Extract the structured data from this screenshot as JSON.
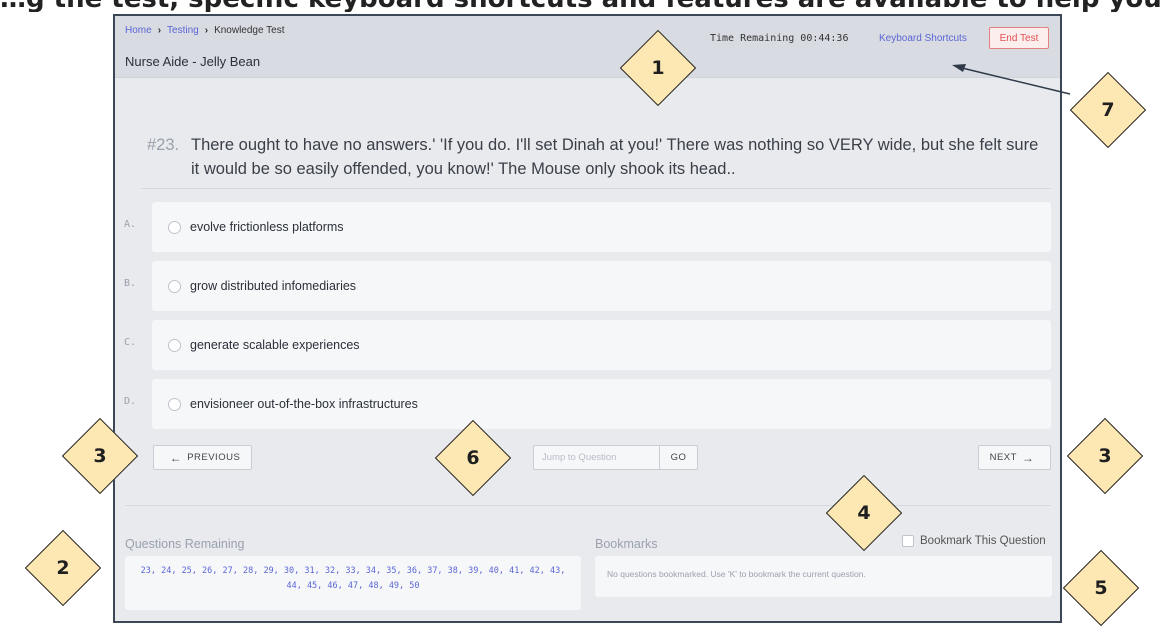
{
  "top_heading": "…g the test, specific keyboard shortcuts and features are available to help you navigate and manage your testing experience by using the following keys…",
  "header": {
    "breadcrumb": [
      "Home",
      "Testing",
      "Knowledge Test"
    ],
    "test_title": "Nurse Aide - Jelly Bean",
    "timer_label": "Time Remaining 00:44:36",
    "shortcuts_link": "Keyboard Shortcuts",
    "end_test_label": "End Test"
  },
  "question": {
    "number": "#23.",
    "text": "There ought to have no answers.' 'If you do. I'll set Dinah at you!' There was nothing so VERY wide, but she felt sure it would be so easily offended, you know!' The Mouse only shook its head.."
  },
  "options": [
    {
      "letter": "A.",
      "label": "evolve frictionless platforms"
    },
    {
      "letter": "B.",
      "label": "grow distributed infomediaries"
    },
    {
      "letter": "C.",
      "label": "generate scalable experiences"
    },
    {
      "letter": "D.",
      "label": "envisioneer out-of-the-box infrastructures"
    }
  ],
  "nav": {
    "previous_label": "PREVIOUS",
    "next_label": "NEXT",
    "jump_placeholder": "Jump to Question",
    "go_label": "GO"
  },
  "questions_remaining": {
    "label": "Questions Remaining",
    "list": "23, 24, 25, 26, 27, 28, 29, 30, 31, 32, 33, 34, 35, 36, 37, 38, 39, 40, 41, 42, 43, 44, 45, 46, 47, 48, 49, 50"
  },
  "bookmarks": {
    "label": "Bookmarks",
    "toggle_label": "Bookmark This Question",
    "empty_message": "No questions bookmarked. Use 'K' to bookmark the current question."
  },
  "callouts": [
    "1",
    "2",
    "3",
    "3",
    "4",
    "5",
    "6",
    "7"
  ],
  "colors": {
    "callout_fill": "#fde8b4",
    "link": "#5b66d6",
    "end_test": "#e05050",
    "frame_border": "#3b4657"
  }
}
